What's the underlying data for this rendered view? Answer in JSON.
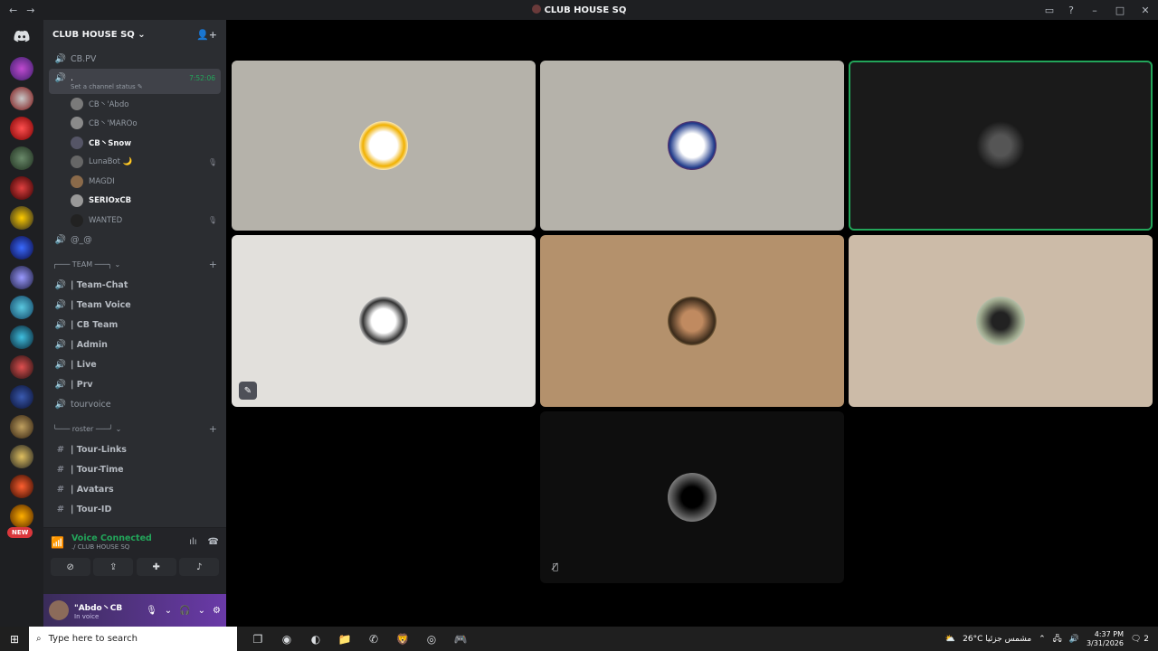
{
  "window": {
    "title": "CLUB HOUSE SQ",
    "back_icon": "arrow-left-icon",
    "forward_icon": "arrow-right-icon"
  },
  "server": {
    "name": "CLUB HOUSE SQ",
    "name_suffix": "⌄"
  },
  "channels": {
    "top": {
      "name": "CB.PV"
    },
    "active": {
      "name": ".",
      "timer": "7:52:06",
      "status": "Set a channel status ✎"
    },
    "users": [
      {
        "name": "CB丶'Abdo",
        "highlight": false,
        "side": ""
      },
      {
        "name": "CB丶'MAROo",
        "highlight": false,
        "side": ""
      },
      {
        "name": "CB丶Snow",
        "highlight": true,
        "side": ""
      },
      {
        "name": "LunaBot 🌙",
        "highlight": false,
        "side": "🎙"
      },
      {
        "name": "MAGDI",
        "highlight": false,
        "side": ""
      },
      {
        "name": "SERIOxCB",
        "highlight": true,
        "side": ""
      },
      {
        "name": "WANTED",
        "highlight": false,
        "side": "🎙"
      }
    ],
    "after": {
      "name": "@_@"
    },
    "category_team": "╭─── TEAM ───╮ ⌄",
    "team": [
      {
        "name": "| Team-Chat"
      },
      {
        "name": "| Team Voice"
      },
      {
        "name": "| CB Team"
      },
      {
        "name": "| Admin"
      },
      {
        "name": "| Live"
      },
      {
        "name": "| Prv"
      }
    ],
    "tourvoice": "tourvoice",
    "category_roster": "╰─── roster ───╯ ⌄",
    "roster": [
      {
        "name": "| Tour-Links"
      },
      {
        "name": "| Tour-Time"
      },
      {
        "name": "| Avatars"
      },
      {
        "name": "| Tour-ID"
      }
    ]
  },
  "voice": {
    "status": "Voice Connected",
    "location": "./ CLUB HOUSE SQ"
  },
  "user_panel": {
    "name": "\"Abdo丶CB",
    "status": "In voice"
  },
  "guild_new_badge": "NEW",
  "taskbar": {
    "search_placeholder": "Type here to search",
    "weather": "26°C مشمس جزئيا",
    "time": "4:37 PM",
    "date": "3/31/2026",
    "notifications": "2"
  },
  "colors": {
    "accent_green": "#23a55a",
    "panel_bg": "#2b2d31",
    "rail_bg": "#1e1f22"
  }
}
